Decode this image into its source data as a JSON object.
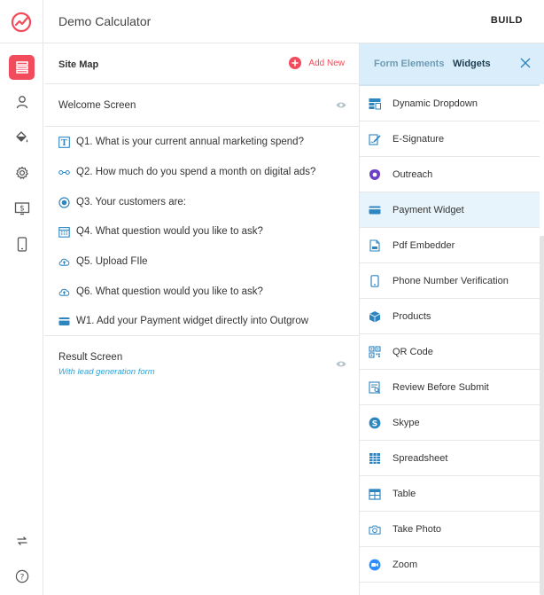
{
  "header": {
    "app_title": "Demo Calculator",
    "build_label": "BUILD"
  },
  "rail": {
    "items": [
      {
        "icon": "sitemap-icon"
      },
      {
        "icon": "user-icon"
      },
      {
        "icon": "paint-bucket-icon"
      },
      {
        "icon": "gear-icon"
      },
      {
        "icon": "dollar-icon"
      },
      {
        "icon": "mobile-icon"
      },
      {
        "icon": "refresh-icon"
      },
      {
        "icon": "help-icon"
      }
    ]
  },
  "sitemap": {
    "title": "Site Map",
    "add_new": "Add New",
    "welcome": "Welcome Screen",
    "questions": [
      {
        "label": "Q1. What is your current annual marketing spend?",
        "icon": "text-icon"
      },
      {
        "label": "Q2. How much do you spend a month on digital ads?",
        "icon": "slider-icon"
      },
      {
        "label": "Q3. Your customers are:",
        "icon": "radio-icon"
      },
      {
        "label": "Q4. What question would you like to ask?",
        "icon": "calendar-icon"
      },
      {
        "label": "Q5. Upload FIle",
        "icon": "upload-cloud-icon"
      },
      {
        "label": "Q6. What question would you like to ask?",
        "icon": "upload-cloud-icon"
      },
      {
        "label": "W1. Add your Payment widget directly into Outgrow",
        "icon": "card-icon"
      }
    ],
    "result": {
      "label": "Result Screen",
      "subtitle": "With lead generation form"
    }
  },
  "rpanel": {
    "tab_form_elements": "Form Elements",
    "tab_widgets": "Widgets",
    "widgets": [
      {
        "label": "Dynamic Dropdown",
        "icon": "dropdown-icon"
      },
      {
        "label": "E-Signature",
        "icon": "signature-icon"
      },
      {
        "label": "Outreach",
        "icon": "outreach-icon"
      },
      {
        "label": "Payment Widget",
        "icon": "card-icon"
      },
      {
        "label": "Pdf Embedder",
        "icon": "pdf-icon"
      },
      {
        "label": "Phone Number Verification",
        "icon": "phone-icon"
      },
      {
        "label": "Products",
        "icon": "box-icon"
      },
      {
        "label": "QR Code",
        "icon": "qr-icon"
      },
      {
        "label": "Review Before Submit",
        "icon": "review-icon"
      },
      {
        "label": "Skype",
        "icon": "skype-icon"
      },
      {
        "label": "Spreadsheet",
        "icon": "spreadsheet-icon"
      },
      {
        "label": "Table",
        "icon": "table-icon"
      },
      {
        "label": "Take Photo",
        "icon": "camera-icon"
      },
      {
        "label": "Zoom",
        "icon": "zoom-icon"
      }
    ]
  }
}
